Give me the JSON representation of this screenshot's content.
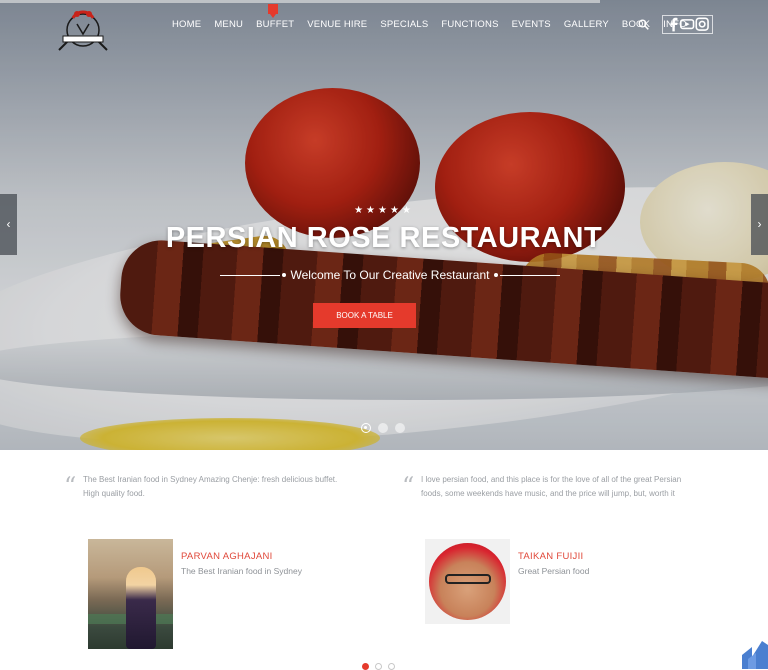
{
  "header": {
    "nav": [
      "HOME",
      "MENU",
      "BUFFET",
      "VENUE HIRE",
      "SPECIALS",
      "FUNCTIONS",
      "EVENTS",
      "GALLERY",
      "BOOK",
      "INFO"
    ],
    "colors": {
      "accent": "#e53a2c",
      "nav_text": "#ffffff"
    },
    "icons": [
      "logo-icon",
      "search-icon",
      "facebook-icon",
      "youtube-icon",
      "instagram-icon"
    ]
  },
  "hero": {
    "stars": "★★★★★",
    "title": "PERSIAN ROSE RESTAURANT",
    "subtitle": "Welcome To Our Creative Restaurant",
    "cta": "BOOK A TABLE",
    "prev_label": "‹",
    "next_label": "›",
    "slides": 3,
    "active_slide": 1
  },
  "testimonials": {
    "quotes": [
      {
        "mark": "“",
        "text": "The Best Iranian food in Sydney Amazing Chenje: fresh delicious buffet. High quality food."
      },
      {
        "mark": "“",
        "text": "I love persian food, and this place is for the love of all of the great Persian foods, some weekends have music, and the price will jump, but, worth it"
      }
    ],
    "people": [
      {
        "name": "PARVAN AGHAJANI",
        "caption": "The Best Iranian food in Sydney"
      },
      {
        "name": "TAIKAN FUIJII",
        "caption": "Great Persian food"
      }
    ],
    "pages": 3,
    "active_page": 1
  }
}
